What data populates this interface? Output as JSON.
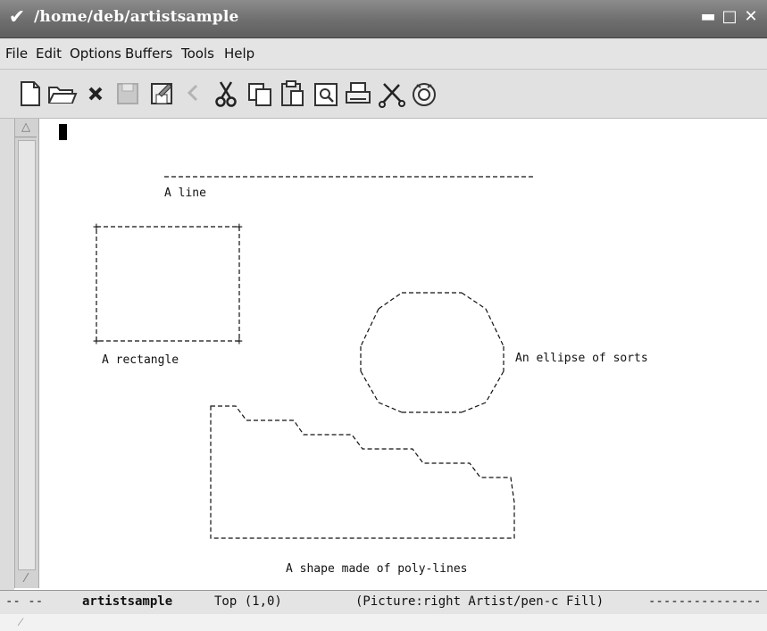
{
  "window": {
    "title": "/home/deb/artistsample",
    "menu_glyph": "✔",
    "minimize_glyph": "▬",
    "maximize_glyph": "□",
    "close_glyph": "✕"
  },
  "menubar": {
    "items": [
      "File",
      "Edit",
      "Options",
      "Buffers",
      "Tools",
      "Help"
    ]
  },
  "toolbar": {
    "icons": [
      "new-file-icon",
      "open-folder-icon",
      "close-icon",
      "save-icon",
      "save-as-icon",
      "undo-icon",
      "cut-icon",
      "copy-icon",
      "paste-icon",
      "search-icon",
      "print-icon",
      "preferences-icon",
      "help-icon"
    ]
  },
  "picture": {
    "line_label": "A line",
    "rectangle_label": "A rectangle",
    "ellipse_label": "An ellipse of sorts",
    "polyline_label": "A shape made of poly-lines"
  },
  "modeline": {
    "prefix": "-- --",
    "buffer": "artistsample",
    "position": "Top (1,0)",
    "modes": "(Picture:right Artist/pen-c Fill)",
    "fill": "---------------"
  },
  "colors": {
    "titlebar": "#6e6e6e",
    "background": "#ffffff"
  }
}
